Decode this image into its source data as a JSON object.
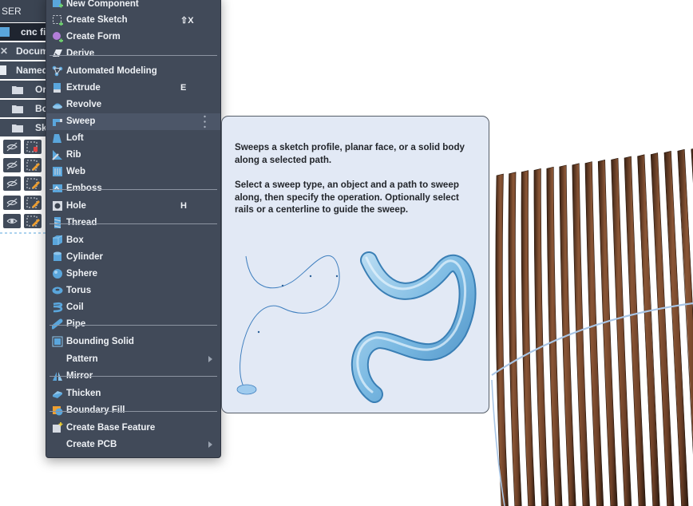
{
  "browser": {
    "header_label": "SER",
    "rows": [
      {
        "label": "cnc fi"
      },
      {
        "label": "Docum"
      },
      {
        "label": "Named"
      },
      {
        "label": "Or"
      },
      {
        "label": "Bo"
      },
      {
        "label": "Sk"
      }
    ]
  },
  "menu": {
    "items": [
      {
        "label": "New Component",
        "shortcut": "",
        "icon": "new-component-icon"
      },
      {
        "label": "Create Sketch",
        "shortcut": "⇧X",
        "icon": "create-sketch-icon"
      },
      {
        "label": "Create Form",
        "shortcut": "",
        "icon": "create-form-icon"
      },
      {
        "label": "Derive",
        "shortcut": "",
        "icon": "derive-icon"
      },
      {
        "label": "Automated Modeling",
        "shortcut": "",
        "icon": "automated-modeling-icon"
      },
      {
        "label": "Extrude",
        "shortcut": "E",
        "icon": "extrude-icon"
      },
      {
        "label": "Revolve",
        "shortcut": "",
        "icon": "revolve-icon"
      },
      {
        "label": "Sweep",
        "shortcut": "",
        "icon": "sweep-icon"
      },
      {
        "label": "Loft",
        "shortcut": "",
        "icon": "loft-icon"
      },
      {
        "label": "Rib",
        "shortcut": "",
        "icon": "rib-icon"
      },
      {
        "label": "Web",
        "shortcut": "",
        "icon": "web-icon"
      },
      {
        "label": "Emboss",
        "shortcut": "",
        "icon": "emboss-icon"
      },
      {
        "label": "Hole",
        "shortcut": "H",
        "icon": "hole-icon"
      },
      {
        "label": "Thread",
        "shortcut": "",
        "icon": "thread-icon"
      },
      {
        "label": "Box",
        "shortcut": "",
        "icon": "box-icon"
      },
      {
        "label": "Cylinder",
        "shortcut": "",
        "icon": "cylinder-icon"
      },
      {
        "label": "Sphere",
        "shortcut": "",
        "icon": "sphere-icon"
      },
      {
        "label": "Torus",
        "shortcut": "",
        "icon": "torus-icon"
      },
      {
        "label": "Coil",
        "shortcut": "",
        "icon": "coil-icon"
      },
      {
        "label": "Pipe",
        "shortcut": "",
        "icon": "pipe-icon"
      },
      {
        "label": "Bounding Solid",
        "shortcut": "",
        "icon": "bounding-solid-icon"
      },
      {
        "label": "Pattern",
        "shortcut": "",
        "icon": ""
      },
      {
        "label": "Mirror",
        "shortcut": "",
        "icon": "mirror-icon"
      },
      {
        "label": "Thicken",
        "shortcut": "",
        "icon": "thicken-icon"
      },
      {
        "label": "Boundary Fill",
        "shortcut": "",
        "icon": "boundary-fill-icon"
      },
      {
        "label": "Create Base Feature",
        "shortcut": "",
        "icon": "create-base-feature-icon"
      },
      {
        "label": "Create PCB",
        "shortcut": "",
        "icon": ""
      }
    ],
    "highlighted": "Sweep"
  },
  "tooltip": {
    "paragraph1": "Sweeps a sketch profile, planar face, or a solid body along a selected path.",
    "paragraph2": "Select a sweep type, an object and a path to sweep along, then specify the operation. Optionally select rails or a centerline to guide the sweep."
  },
  "colors": {
    "menu_bg": "#414a59",
    "menu_text": "#eef1f5",
    "tooltip_bg": "#e2e9f5",
    "icon_blue": "#5aa6dc",
    "wood": "#7a4a2c"
  }
}
